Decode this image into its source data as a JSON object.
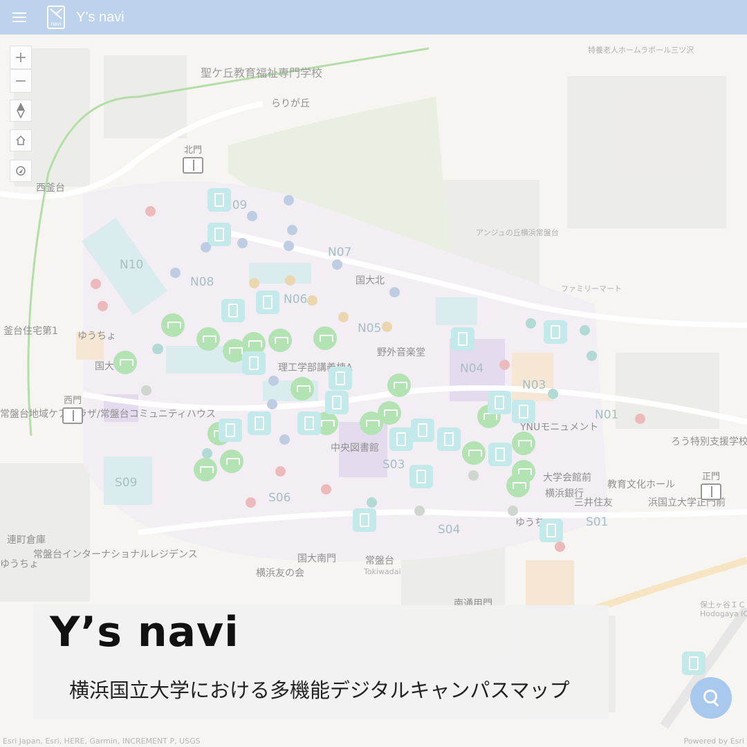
{
  "header": {
    "menu_icon": "hamburger-menu-icon",
    "logo_text": "navi",
    "title": "Y’s navi",
    "background": "#bdd3ec"
  },
  "controls": {
    "zoom_in": "+",
    "zoom_out": "−",
    "compass_icon": "compass-icon",
    "home_icon": "home-icon",
    "locate_icon": "locate-icon"
  },
  "map": {
    "place_labels": {
      "school": "聖ケ丘教育福祉専門学校",
      "nishi_umedai": "西釜台",
      "rakuwa": "らりが丘",
      "kodai_kita": "国大北",
      "rikou_kougi": "理工学部講義棟A",
      "yagai": "野外音楽堂",
      "chuo_tosho": "中央図書館",
      "ynu_monument": "YNUモニュメント",
      "daigaku_kaikan": "大学会館前",
      "yokohama_bank": "横浜銀行",
      "mitsui": "三井住友",
      "kyoiku_hall": "教育文化ホール",
      "kokuritsu_seimon": "浜国立大学正門前",
      "yuucho1": "ゆうちょ",
      "yuucho2": "ゆうちょ",
      "yuucho3": "ゆうちょ",
      "tokiwadai_plaza": "常盤台地域ケアプラザ/常盤台コミュニティハウス",
      "international": "常盤台インターナショナルレジデンス",
      "renmachi": "連町倉庫",
      "tokiwadai": "常盤台",
      "tokiwadai_en": "Tokiwadai",
      "kodai_minami": "国大南門",
      "yokohama_tomo": "横浜友の会",
      "family": "ファミリーマート",
      "ansheng": "アンジュの丘横浜常盤台",
      "rouhouse": "ろう特別支援学校",
      "hodogaya_ic": "保土ヶ谷ＩＣ",
      "hodogaya_ic_en": "Hodogaya IC",
      "kamaidai": "釜台住宅第1",
      "minami_doori": "南通用門",
      "home": "特養老人ホームラポール三ツ沢",
      "kodai_dai": "国大"
    },
    "zones": [
      "N09",
      "N07",
      "N10",
      "N08",
      "N06",
      "N05",
      "N04",
      "N03",
      "N01",
      "S09",
      "S06",
      "S03",
      "S04",
      "S01"
    ],
    "gates": {
      "north": "北門",
      "west": "西門",
      "main": "正門"
    }
  },
  "banner": {
    "title": "Y’s  navi",
    "subtitle": "横浜国立大学における多機能デジタルキャンパスマップ"
  },
  "search": {
    "icon": "search-icon",
    "color": "#a8c8ee"
  },
  "attribution": {
    "left": "Esri Japan, Esri, HERE, Garmin, INCREMENT P, USGS",
    "right": "Powered by Esri"
  }
}
